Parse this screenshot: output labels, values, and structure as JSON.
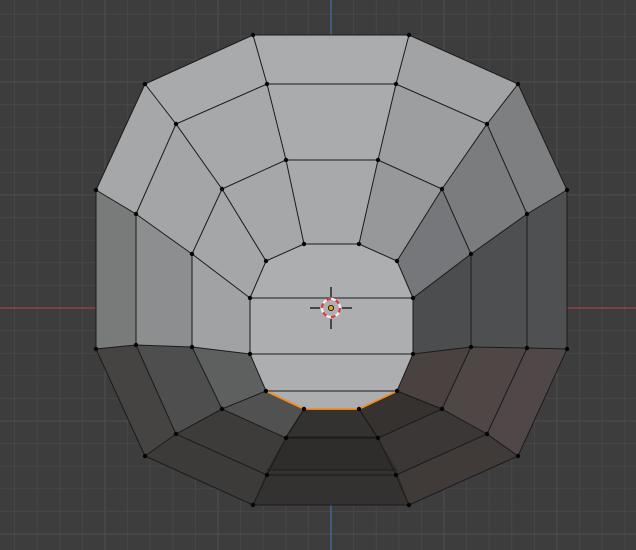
{
  "viewport": {
    "colors": {
      "background": "#3d3d3d",
      "grid_minor": "#474747",
      "grid_major": "#4f4f4f",
      "axis_x": "#a5404d",
      "axis_y": "#3f6ea1",
      "edge": "#1b1b1b",
      "vertex": "#050505",
      "selected_edge": "#f58d22",
      "cursor_red": "#e3333d",
      "cursor_white": "#f2f2f2",
      "origin": "#e8a21a"
    },
    "icons": {
      "cursor": "3d-cursor-icon",
      "origin": "object-origin-icon"
    }
  }
}
